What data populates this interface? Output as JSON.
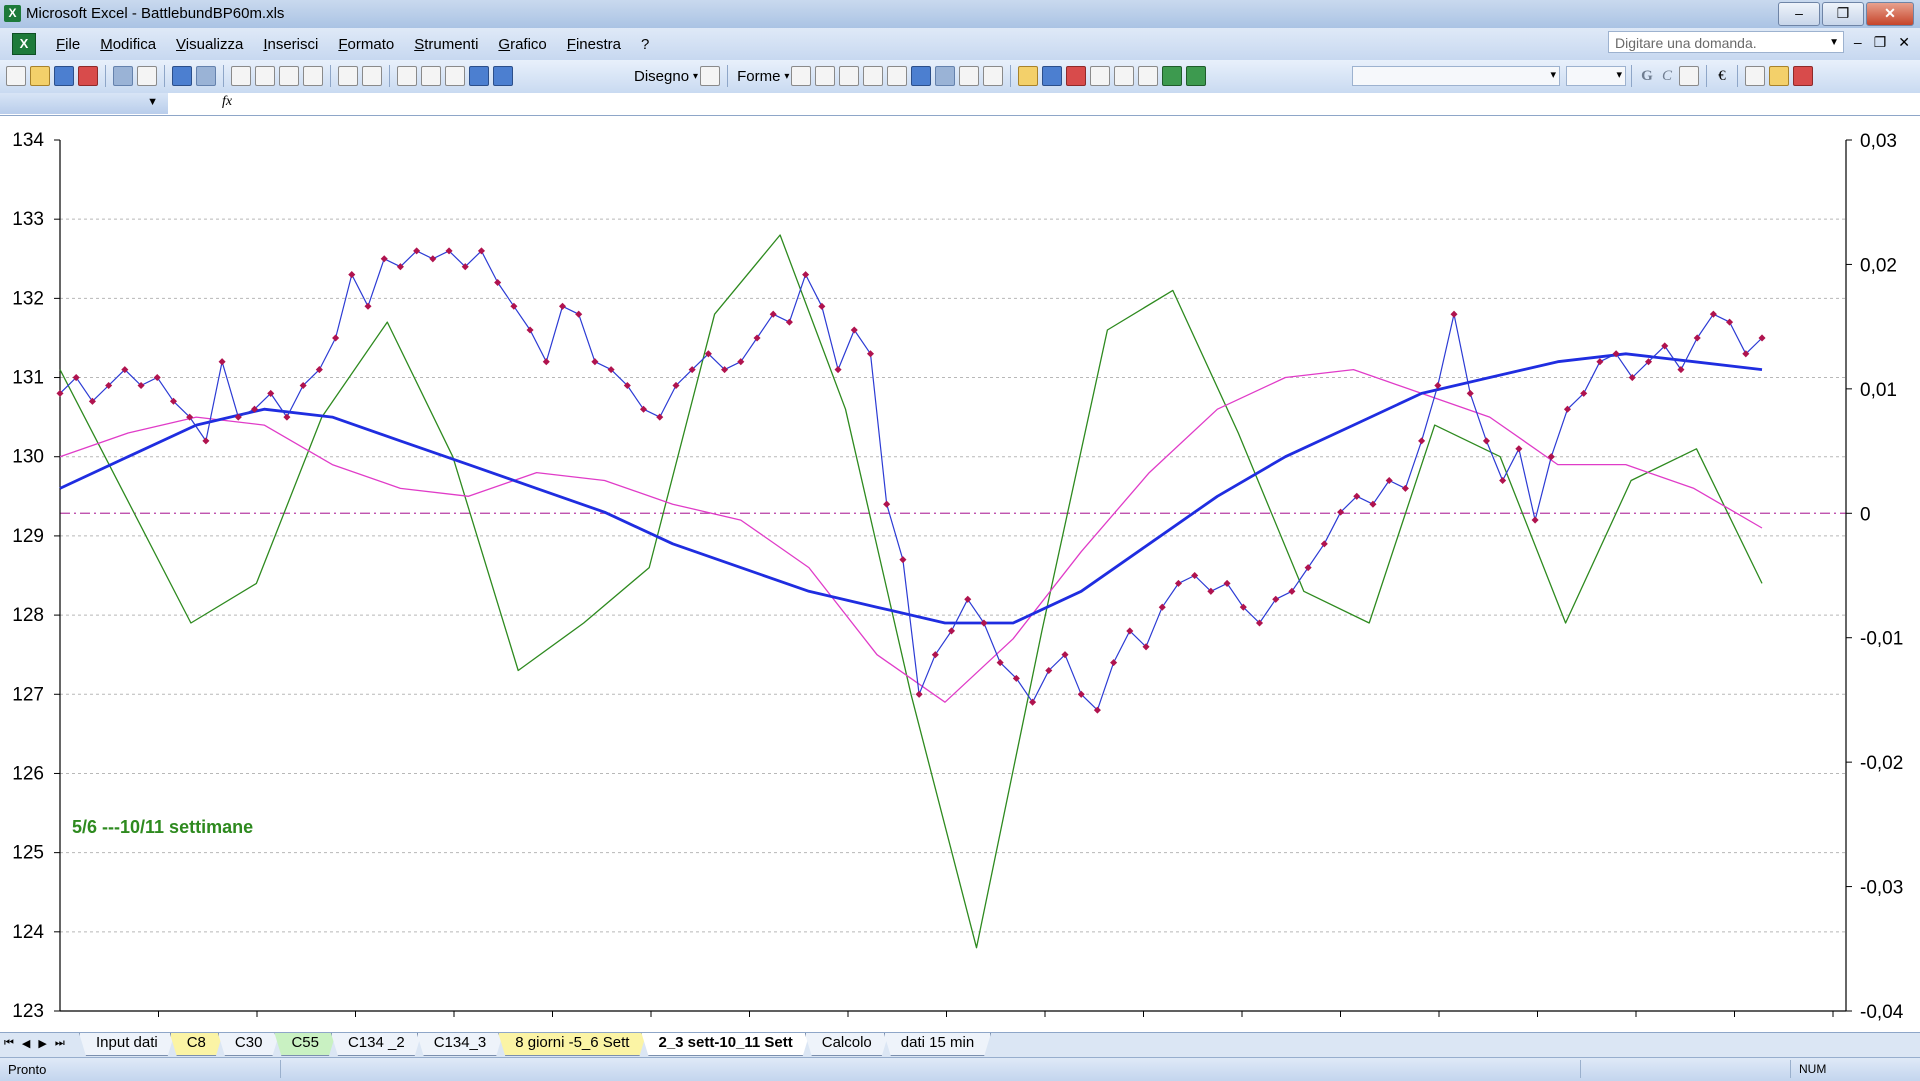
{
  "window": {
    "title": "Microsoft Excel - BattlebundBP60m.xls"
  },
  "menu": {
    "items": [
      "File",
      "Modifica",
      "Visualizza",
      "Inserisci",
      "Formato",
      "Strumenti",
      "Grafico",
      "Finestra",
      "?"
    ],
    "help_placeholder": "Digitare una domanda."
  },
  "toolbar": {
    "draw_label": "Disegno",
    "shapes_label": "Forme",
    "bold": "G",
    "italic": "C",
    "euro": "€"
  },
  "formula_bar": {
    "fx": "fx"
  },
  "chart_data": {
    "type": "line",
    "title": "",
    "annotation": "5/6 ---10/11 settimane",
    "left_axis": {
      "ticks": [
        "134",
        "133",
        "132",
        "131",
        "130",
        "129",
        "128",
        "127",
        "126",
        "125",
        "124",
        "123"
      ],
      "ylim": [
        123,
        134
      ]
    },
    "right_axis": {
      "ticks": [
        "0,03",
        "0,02",
        "0,01",
        "0",
        "-0,01",
        "-0,02",
        "-0,03",
        "-0,04"
      ],
      "ylim": [
        -0.04,
        0.03
      ]
    },
    "grid": "horizontal dotted",
    "series": [
      {
        "color": "#b0134e",
        "style": "line with diamond markers",
        "axis": "left",
        "values": [
          130.8,
          131.0,
          130.7,
          130.9,
          131.1,
          130.9,
          131.0,
          130.7,
          130.5,
          130.2,
          131.2,
          130.5,
          130.6,
          130.8,
          130.5,
          130.9,
          131.1,
          131.5,
          132.3,
          131.9,
          132.5,
          132.4,
          132.6,
          132.5,
          132.6,
          132.4,
          132.6,
          132.2,
          131.9,
          131.6,
          131.2,
          131.9,
          131.8,
          131.2,
          131.1,
          130.9,
          130.6,
          130.5,
          130.9,
          131.1,
          131.3,
          131.1,
          131.2,
          131.5,
          131.8,
          131.7,
          132.3,
          131.9,
          131.1,
          131.6,
          131.3,
          129.4,
          128.7,
          127.0,
          127.5,
          127.8,
          128.2,
          127.9,
          127.4,
          127.2,
          126.9,
          127.3,
          127.5,
          127.0,
          126.8,
          127.4,
          127.8,
          127.6,
          128.1,
          128.4,
          128.5,
          128.3,
          128.4,
          128.1,
          127.9,
          128.2,
          128.3,
          128.6,
          128.9,
          129.3,
          129.5,
          129.4,
          129.7,
          129.6,
          130.2,
          130.9,
          131.8,
          130.8,
          130.2,
          129.7,
          130.1,
          129.2,
          130.0,
          130.6,
          130.8,
          131.2,
          131.3,
          131.0,
          131.2,
          131.4,
          131.1,
          131.5,
          131.8,
          131.7,
          131.3,
          131.5
        ]
      },
      {
        "color": "#1f2de0",
        "style": "thick line",
        "axis": "left",
        "values": [
          129.6,
          130.0,
          130.4,
          130.6,
          130.5,
          130.2,
          129.9,
          129.6,
          129.3,
          128.9,
          128.6,
          128.3,
          128.1,
          127.9,
          127.9,
          128.3,
          128.9,
          129.5,
          130.0,
          130.4,
          130.8,
          131.0,
          131.2,
          131.3,
          131.2,
          131.1
        ]
      },
      {
        "color": "#e03cc8",
        "style": "thin line",
        "axis": "left",
        "values": [
          130.0,
          130.3,
          130.5,
          130.4,
          129.9,
          129.6,
          129.5,
          129.8,
          129.7,
          129.4,
          129.2,
          128.6,
          127.5,
          126.9,
          127.7,
          128.8,
          129.8,
          130.6,
          131.0,
          131.1,
          130.8,
          130.5,
          129.9,
          129.9,
          129.6,
          129.1
        ]
      },
      {
        "color": "#2e8a1f",
        "style": "thin line",
        "axis": "left",
        "values": [
          131.1,
          129.5,
          127.9,
          128.4,
          130.5,
          131.7,
          130.0,
          127.3,
          127.9,
          128.6,
          131.8,
          132.8,
          130.6,
          127.0,
          123.8,
          127.8,
          131.6,
          132.1,
          130.3,
          128.3,
          127.9,
          130.4,
          130.0,
          127.9,
          129.7,
          130.1,
          128.4
        ]
      }
    ]
  },
  "sheet_tabs": [
    "Input dati",
    "C8",
    "C30",
    "C55",
    "C134 _2",
    "C134_3",
    "8 giorni -5_6 Sett",
    "2_3 sett-10_11 Sett",
    "Calcolo",
    "dati 15 min"
  ],
  "status": {
    "left": "Pronto",
    "num": "NUM"
  }
}
